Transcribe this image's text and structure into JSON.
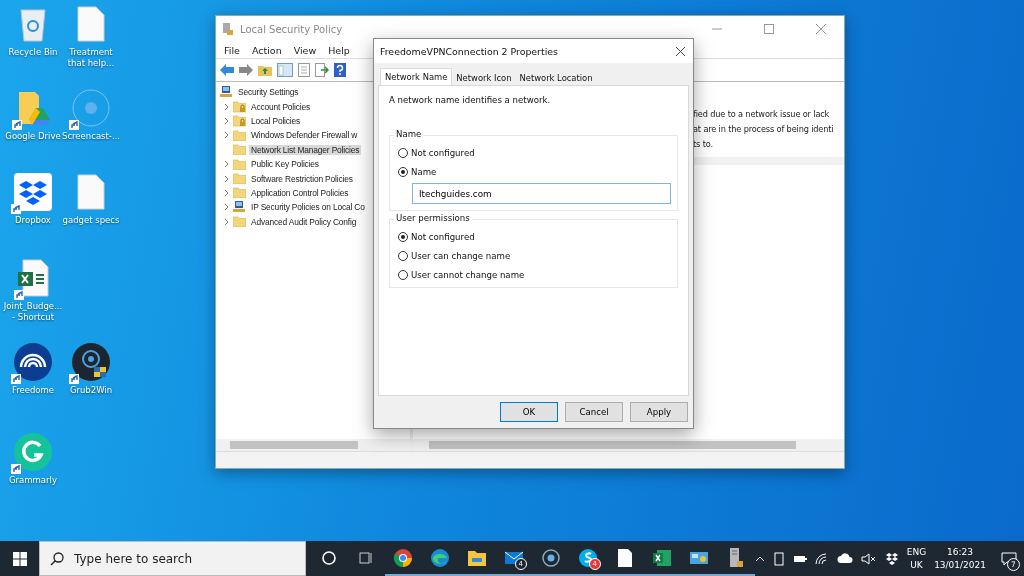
{
  "desktop_icons": [
    {
      "kind": "recycle-bin",
      "label": [
        "Recycle Bin"
      ],
      "shortcut": false
    },
    {
      "kind": "document",
      "label": [
        "Treatment",
        "that help..."
      ],
      "shortcut": false
    },
    {
      "kind": "google-drive",
      "label": [
        "Google Drive"
      ],
      "shortcut": true
    },
    {
      "kind": "screencast",
      "label": [
        "Screencast-..."
      ],
      "shortcut": true
    },
    {
      "kind": "dropbox",
      "label": [
        "Dropbox"
      ],
      "shortcut": true
    },
    {
      "kind": "document",
      "label": [
        "gadget specs"
      ],
      "shortcut": false
    },
    {
      "kind": "excel",
      "label": [
        "Joint_Budge...",
        "- Shortcut"
      ],
      "shortcut": true
    },
    {
      "kind": "freedome",
      "label": [
        "Freedome"
      ],
      "shortcut": true
    },
    {
      "kind": "grub2win",
      "label": [
        "Grub2Win"
      ],
      "shortcut": true
    },
    {
      "kind": "grammarly",
      "label": [
        "Grammarly"
      ],
      "shortcut": true
    }
  ],
  "main_window": {
    "title": "Local Security Policy",
    "menu": [
      "File",
      "Action",
      "View",
      "Help"
    ],
    "tree": {
      "label": "Security Settings",
      "children": [
        {
          "label": "Account Policies",
          "kind": "lock-folder",
          "expandable": true,
          "selected": false
        },
        {
          "label": "Local Policies",
          "kind": "lock-folder",
          "expandable": true,
          "selected": false
        },
        {
          "label": "Windows Defender Firewall w",
          "kind": "folder",
          "expandable": true,
          "selected": false
        },
        {
          "label": "Network List Manager Policies",
          "kind": "folder",
          "expandable": false,
          "selected": true
        },
        {
          "label": "Public Key Policies",
          "kind": "folder",
          "expandable": true,
          "selected": false
        },
        {
          "label": "Software Restriction Policies",
          "kind": "folder",
          "expandable": true,
          "selected": false
        },
        {
          "label": "Application Control Policies",
          "kind": "folder",
          "expandable": true,
          "selected": false
        },
        {
          "label": "IP Security Policies on Local Co",
          "kind": "network-pc",
          "expandable": true,
          "selected": false
        },
        {
          "label": "Advanced Audit Policy Config",
          "kind": "folder",
          "expandable": true,
          "selected": false
        }
      ]
    },
    "pane_text": [
      "fied due to a network issue or lack",
      "at are in the process of being identi",
      "ts to."
    ]
  },
  "dialog": {
    "title": "FreedomeVPNConnection 2 Properties",
    "tabs": [
      {
        "label": "Network Name",
        "selected": true
      },
      {
        "label": "Network Icon",
        "selected": false
      },
      {
        "label": "Network Location",
        "selected": false
      }
    ],
    "description": "A network name identifies a network.",
    "groups": [
      {
        "title": "Name",
        "options": [
          {
            "label": "Not configured",
            "selected": false
          },
          {
            "label": "Name",
            "selected": true
          }
        ],
        "field": {
          "value": "Itechguides.com"
        }
      },
      {
        "title": "User permissions",
        "options": [
          {
            "label": "Not configured",
            "selected": true
          },
          {
            "label": "User can change name",
            "selected": false
          },
          {
            "label": "User cannot change name",
            "selected": false
          }
        ]
      }
    ],
    "buttons": [
      {
        "label": "OK",
        "default": true
      },
      {
        "label": "Cancel",
        "default": false
      },
      {
        "label": "Apply",
        "default": false
      }
    ]
  },
  "taskbar": {
    "search": {
      "placeholder": "Type here to search"
    },
    "apps": [
      {
        "kind": "cortana",
        "running": false
      },
      {
        "kind": "task-view",
        "running": false
      },
      {
        "kind": "chrome",
        "running": true
      },
      {
        "kind": "edge",
        "running": true
      },
      {
        "kind": "explorer",
        "running": true
      },
      {
        "kind": "mail",
        "running": true,
        "badge": "4"
      },
      {
        "kind": "recorder",
        "running": true
      },
      {
        "kind": "skype",
        "running": true,
        "badge": "4"
      },
      {
        "kind": "document",
        "running": true
      },
      {
        "kind": "excel",
        "running": true
      },
      {
        "kind": "control-panel",
        "running": true
      },
      {
        "kind": "server",
        "running": true
      }
    ],
    "tray": {
      "language": [
        "ENG",
        "UK"
      ],
      "time": "16:23",
      "date": "13/01/2021",
      "notifications": "7"
    }
  }
}
